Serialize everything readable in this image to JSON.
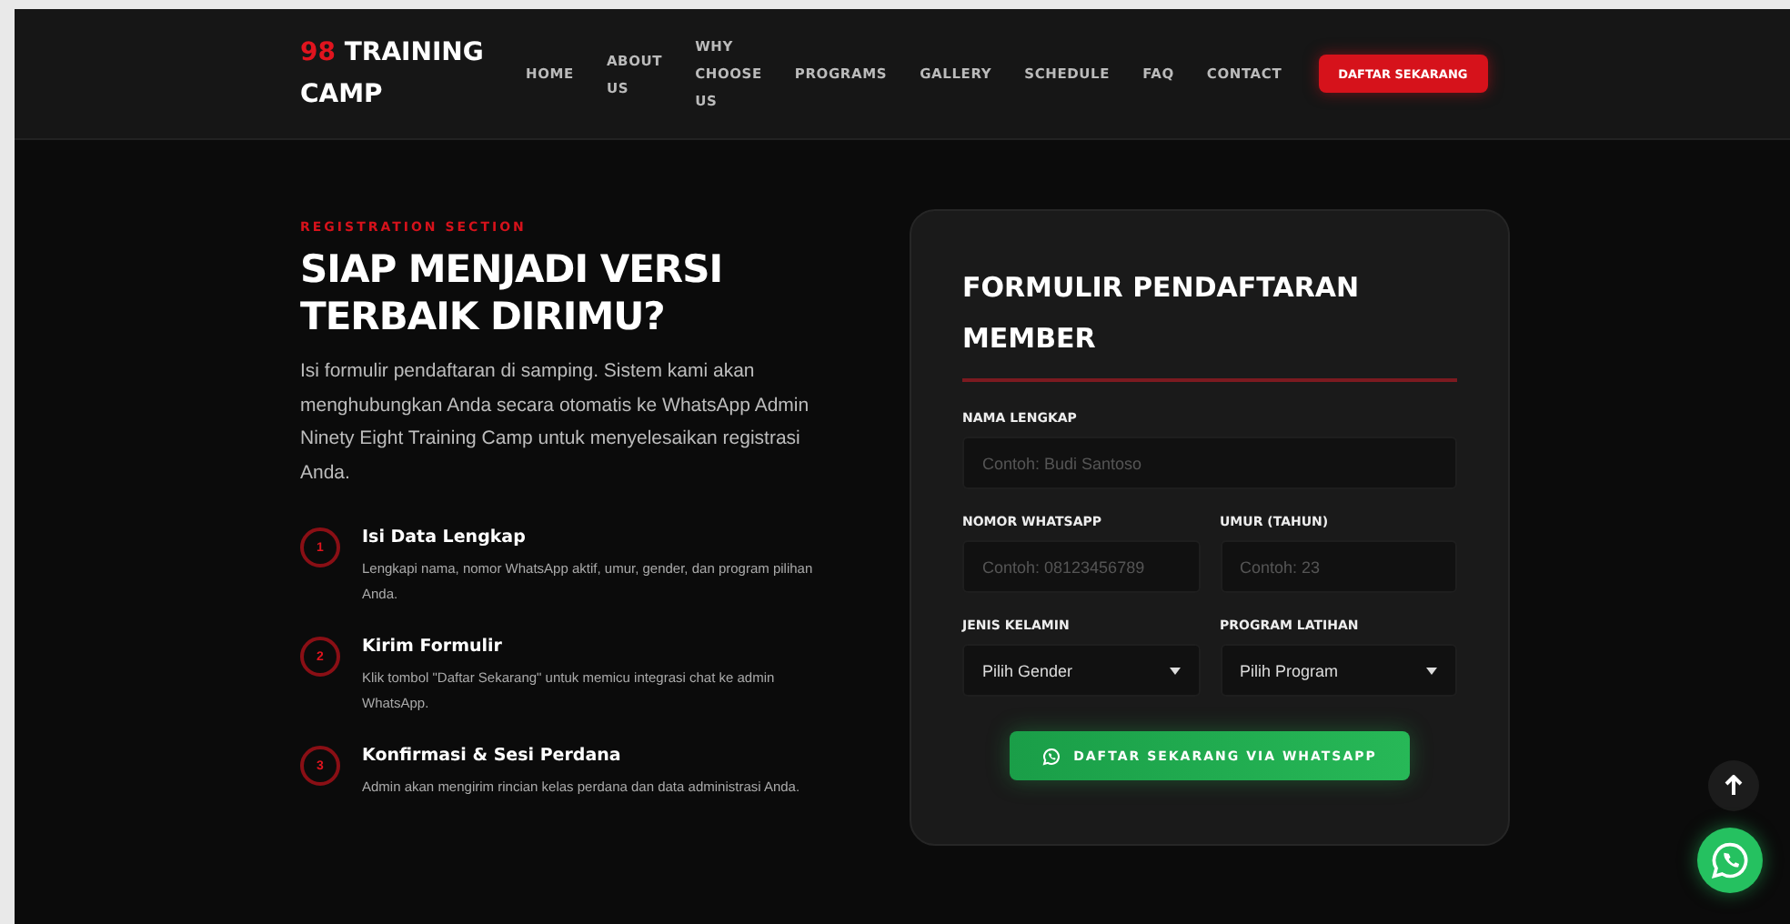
{
  "logo": {
    "accent": "98",
    "text": "TRAINING CAMP"
  },
  "nav": {
    "links": [
      "HOME",
      "ABOUT US",
      "WHY CHOOSE US",
      "PROGRAMS",
      "GALLERY",
      "SCHEDULE",
      "FAQ",
      "CONTACT"
    ],
    "cta": "DAFTAR SEKARANG"
  },
  "intro": {
    "eyebrow": "REGISTRATION SECTION",
    "title": "SIAP MENJADI VERSI TERBAIK DIRIMU?",
    "text": "Isi formulir pendaftaran di samping. Sistem kami akan menghubungkan Anda secara otomatis ke WhatsApp Admin Ninety Eight Training Camp untuk menyelesaikan registrasi Anda."
  },
  "steps": [
    {
      "number": "1",
      "title": "Isi Data Lengkap",
      "text": "Lengkapi nama, nomor WhatsApp aktif, umur, gender, dan program pilihan Anda."
    },
    {
      "number": "2",
      "title": "Kirim Formulir",
      "text": "Klik tombol \"Daftar Sekarang\" untuk memicu integrasi chat ke admin WhatsApp."
    },
    {
      "number": "3",
      "title": "Konfirmasi & Sesi Perdana",
      "text": "Admin akan mengirim rincian kelas perdana dan data administrasi Anda."
    }
  ],
  "form": {
    "title": "FORMULIR PENDAFTARAN MEMBER",
    "fields": [
      {
        "kind": "input",
        "label": "NAMA LENGKAP",
        "placeholder": "Contoh: Budi Santoso"
      },
      {
        "kind": "input",
        "label": "NOMOR WHATSAPP",
        "placeholder": "Contoh: 08123456789"
      },
      {
        "kind": "input",
        "label": "UMUR (TAHUN)",
        "placeholder": "Contoh: 23"
      },
      {
        "kind": "select",
        "label": "JENIS KELAMIN",
        "value": "Pilih Gender"
      },
      {
        "kind": "select",
        "label": "PROGRAM LATIHAN",
        "value": "Pilih Program"
      }
    ],
    "submit": "DAFTAR SEKARANG VIA WHATSAPP"
  }
}
